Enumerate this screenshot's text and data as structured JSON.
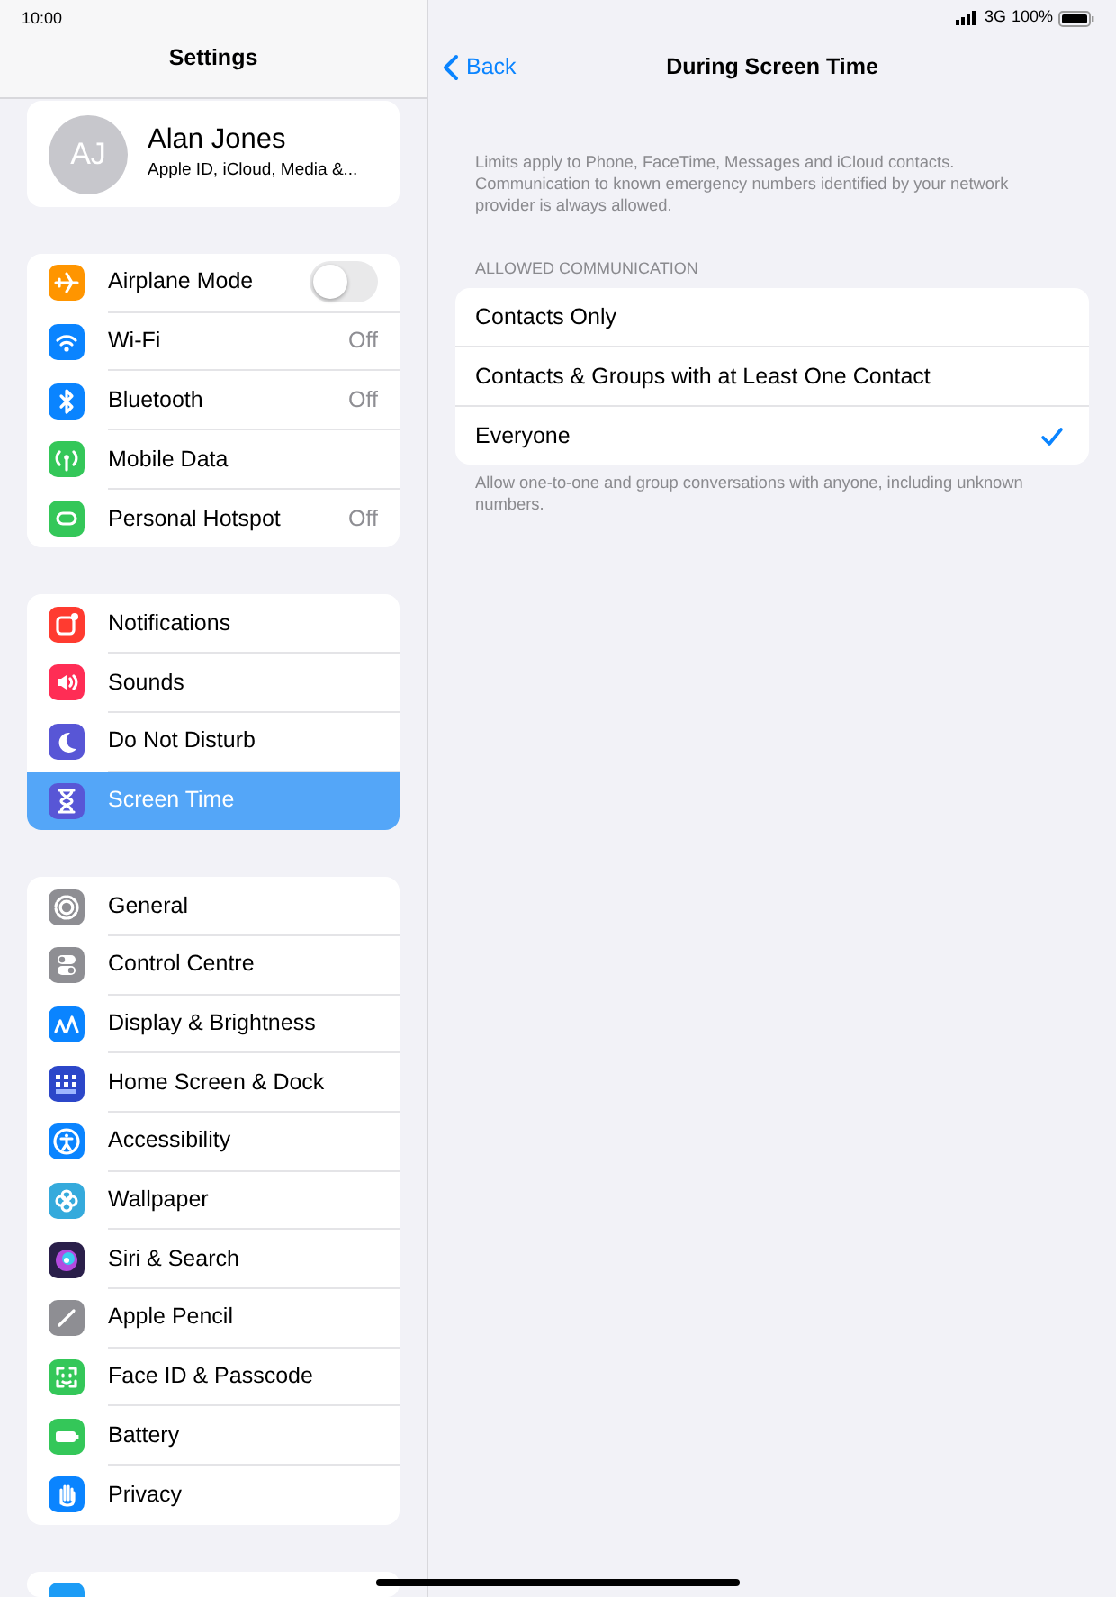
{
  "status_bar": {
    "time": "10:00",
    "network": "3G",
    "battery": "100%"
  },
  "sidebar": {
    "title": "Settings",
    "profile": {
      "initials": "AJ",
      "name": "Alan Jones",
      "subtitle": "Apple ID, iCloud, Media &..."
    },
    "groups": [
      [
        {
          "label": "Airplane Mode",
          "kind": "toggle",
          "on": false,
          "selected": false,
          "color": "#ff9500"
        },
        {
          "label": "Wi-Fi",
          "kind": "link",
          "value": "Off",
          "selected": false,
          "color": "#0a84ff"
        },
        {
          "label": "Bluetooth",
          "kind": "link",
          "value": "Off",
          "selected": false,
          "color": "#0a84ff"
        },
        {
          "label": "Mobile Data",
          "kind": "link",
          "selected": false,
          "color": "#34c759"
        },
        {
          "label": "Personal Hotspot",
          "kind": "link",
          "value": "Off",
          "selected": false,
          "color": "#34c759"
        }
      ],
      [
        {
          "label": "Notifications",
          "kind": "link",
          "selected": false,
          "color": "#ff3b30"
        },
        {
          "label": "Sounds",
          "kind": "link",
          "selected": false,
          "color": "#ff2d55"
        },
        {
          "label": "Do Not Disturb",
          "kind": "link",
          "selected": false,
          "color": "#5856d6"
        },
        {
          "label": "Screen Time",
          "kind": "link",
          "selected": true,
          "color": "#5856d6"
        }
      ],
      [
        {
          "label": "General",
          "kind": "link",
          "selected": false,
          "color": "#8e8e93"
        },
        {
          "label": "Control Centre",
          "kind": "link",
          "selected": false,
          "color": "#8e8e93"
        },
        {
          "label": "Display & Brightness",
          "kind": "link",
          "selected": false,
          "color": "#0a84ff"
        },
        {
          "label": "Home Screen & Dock",
          "kind": "link",
          "selected": false,
          "color": "#2c47c9"
        },
        {
          "label": "Accessibility",
          "kind": "link",
          "selected": false,
          "color": "#0a84ff"
        },
        {
          "label": "Wallpaper",
          "kind": "link",
          "selected": false,
          "color": "#35aadc"
        },
        {
          "label": "Siri & Search",
          "kind": "link",
          "selected": false,
          "color": "#2a1f4a"
        },
        {
          "label": "Apple Pencil",
          "kind": "link",
          "selected": false,
          "color": "#8e8e93"
        },
        {
          "label": "Face ID & Passcode",
          "kind": "link",
          "selected": false,
          "color": "#34c759"
        },
        {
          "label": "Battery",
          "kind": "link",
          "selected": false,
          "color": "#34c759"
        },
        {
          "label": "Privacy",
          "kind": "link",
          "selected": false,
          "color": "#0a84ff"
        }
      ],
      [
        {
          "kind": "partial",
          "color": "#1c9cf6"
        }
      ]
    ]
  },
  "detail": {
    "back": "Back",
    "title": "During Screen Time",
    "description": "Limits apply to Phone, FaceTime, Messages and iCloud contacts. Communication to known emergency numbers identified by your network provider is always allowed.",
    "section_header": "ALLOWED COMMUNICATION",
    "options": [
      {
        "label": "Contacts Only",
        "selected": false
      },
      {
        "label": "Contacts & Groups with at Least One Contact",
        "selected": false
      },
      {
        "label": "Everyone",
        "selected": true
      }
    ],
    "footer": "Allow one-to-one and group conversations with anyone, including unknown numbers."
  }
}
